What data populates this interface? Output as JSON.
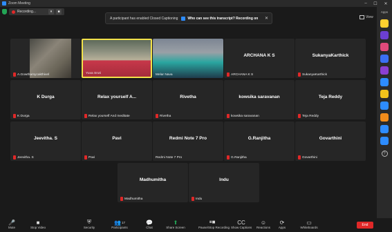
{
  "window": {
    "title": "Zoom Meeting",
    "minimize": "–",
    "maximize": "☐",
    "close": "✕"
  },
  "recording": {
    "label": "Recording...",
    "pause": "⏸",
    "stop": "■"
  },
  "banner": {
    "text": "A participant has enabled Closed Captioning",
    "link": "Who can see this transcript? Recording on",
    "close": "✕"
  },
  "view": {
    "label": "View"
  },
  "sidebar": {
    "label": "Apps",
    "apps": [
      {
        "name": "miro-app",
        "color": "#ffd02f"
      },
      {
        "name": "webex-app",
        "color": "#6c3fd1"
      },
      {
        "name": "game-app",
        "color": "#e04a7b"
      },
      {
        "name": "calendar-app",
        "color": "#3a6ff2"
      },
      {
        "name": "notes-app",
        "color": "#8b3fd1"
      },
      {
        "name": "sheets-app",
        "color": "#2d8cff"
      },
      {
        "name": "smile-app",
        "color": "#f2c21b"
      },
      {
        "name": "docs-app",
        "color": "#2d8cff"
      },
      {
        "name": "slides-app",
        "color": "#f28c1b"
      },
      {
        "name": "sync-app",
        "color": "#2d8cff"
      },
      {
        "name": "cloud-app",
        "color": "#2d8cff"
      }
    ],
    "help": "?"
  },
  "participants": [
    {
      "label": "A.Gowthamycakthivel",
      "display": "",
      "type": "video",
      "muted": true
    },
    {
      "label": "Yuva Sruti",
      "display": "",
      "type": "video",
      "muted": false,
      "active": true
    },
    {
      "label": "Melar Nava",
      "display": "",
      "type": "video",
      "muted": false
    },
    {
      "label": "ARCHANA K S",
      "display": "ARCHANA K S",
      "type": "name",
      "muted": true
    },
    {
      "label": "SukanyaKarthick",
      "display": "SukanyaKarthick",
      "type": "name",
      "muted": true
    },
    {
      "label": "K Durga",
      "display": "K Durga",
      "type": "name",
      "muted": true
    },
    {
      "label": "Relax yourself And meditate",
      "display": "Relax yourself A...",
      "type": "name",
      "muted": true
    },
    {
      "label": "Rivetha",
      "display": "Rivetha",
      "type": "name",
      "muted": true
    },
    {
      "label": "kowsika saravanan",
      "display": "kowsika saravanan",
      "type": "name",
      "muted": true
    },
    {
      "label": "Teja Reddy",
      "display": "Teja Reddy",
      "type": "name",
      "muted": true
    },
    {
      "label": "Jeevitha. S",
      "display": "Jeevitha. S",
      "type": "name",
      "muted": true
    },
    {
      "label": "Pavi",
      "display": "Pavi",
      "type": "name",
      "muted": true
    },
    {
      "label": "Redmi Note 7 Pro",
      "display": "Redmi Note 7 Pro",
      "type": "name",
      "muted": false
    },
    {
      "label": "G.Ranjitha",
      "display": "G.Ranjitha",
      "type": "name",
      "muted": true
    },
    {
      "label": "Govarthini",
      "display": "Govarthini",
      "type": "name",
      "muted": true
    },
    {
      "label": "Madhumitha",
      "display": "Madhumitha",
      "type": "name",
      "muted": true
    },
    {
      "label": "Indu",
      "display": "Indu",
      "type": "name",
      "muted": true
    }
  ],
  "toolbar": {
    "buttons": [
      {
        "label": "Mute",
        "icon": "🎤"
      },
      {
        "label": "Stop Video",
        "icon": "■"
      },
      {
        "label": "Security",
        "icon": "⛨"
      },
      {
        "label": "Participants",
        "icon": "👥",
        "count": "17"
      },
      {
        "label": "Chat",
        "icon": "💬"
      },
      {
        "label": "Share Screen",
        "icon": "⬆"
      },
      {
        "label": "Pause/Stop Recording",
        "icon": "⏸■"
      },
      {
        "label": "Show Captions",
        "icon": "CC"
      },
      {
        "label": "Reactions",
        "icon": "☺"
      },
      {
        "label": "Apps",
        "icon": "⟳"
      },
      {
        "label": "Whiteboards",
        "icon": "▭"
      }
    ],
    "end": "End"
  }
}
